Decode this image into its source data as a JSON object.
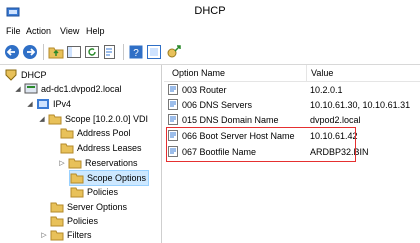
{
  "window": {
    "title": "DHCP"
  },
  "menu": [
    "File",
    "Action",
    "View",
    "Help"
  ],
  "toolbar_icons": [
    "back-arrow-icon",
    "forward-arrow-icon",
    "up-folder-icon",
    "show-hide-tree-icon",
    "refresh-icon",
    "export-list-icon",
    "help-icon",
    "properties-icon",
    "add-server-icon"
  ],
  "tree": {
    "root": "DHCP",
    "server": "ad-dc1.dvpod2.local",
    "ipv4": "IPv4",
    "scope": "Scope [10.2.0.0] VDI",
    "scope_children": [
      "Address Pool",
      "Address Leases",
      "Reservations",
      "Scope Options",
      "Policies"
    ],
    "ipv4_children": [
      "Server Options",
      "Policies",
      "Filters"
    ],
    "selected": "Scope Options"
  },
  "list": {
    "columns": [
      "Option Name",
      "Value"
    ],
    "rows": [
      {
        "name": "003 Router",
        "value": "10.2.0.1"
      },
      {
        "name": "006 DNS Servers",
        "value": "10.10.61.30, 10.10.61.31"
      },
      {
        "name": "015 DNS Domain Name",
        "value": "dvpod2.local"
      },
      {
        "name": "066 Boot Server Host Name",
        "value": "10.10.61.42"
      },
      {
        "name": "067 Bootfile Name",
        "value": "ARDBP32.BIN"
      }
    ]
  },
  "colors": {
    "highlight_border": "#e53030",
    "selection": "#cde8ff",
    "folder": "#e8c15a"
  }
}
